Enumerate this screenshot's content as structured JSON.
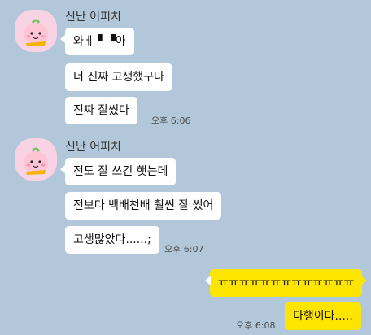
{
  "chat": {
    "group1": {
      "sender": "신난 어피치",
      "msg1": "와ㅔ ▘▝아",
      "msg2": "너 진짜 고생했구나",
      "msg3": "진짜 잘썼다",
      "time": "오후 6:06"
    },
    "group2": {
      "sender": "신난 어피치",
      "msg1": "전도 잘 쓰긴 햇는데",
      "msg2": "전보다 백배천배 훨씬 잘 썼어",
      "msg3": "고생많았다......;",
      "time": "오후 6:07"
    },
    "mine": {
      "msg1": "ㅠㅠㅠㅠㅠㅠㅠㅠㅠㅠㅠㅠㅠ",
      "msg2": "다행이다.....",
      "time": "오후 6:08"
    }
  },
  "colors": {
    "background": "#b2c7da",
    "my_bubble": "#fee500",
    "their_bubble": "#ffffff",
    "avatar_bg": "#f8d3e3"
  }
}
